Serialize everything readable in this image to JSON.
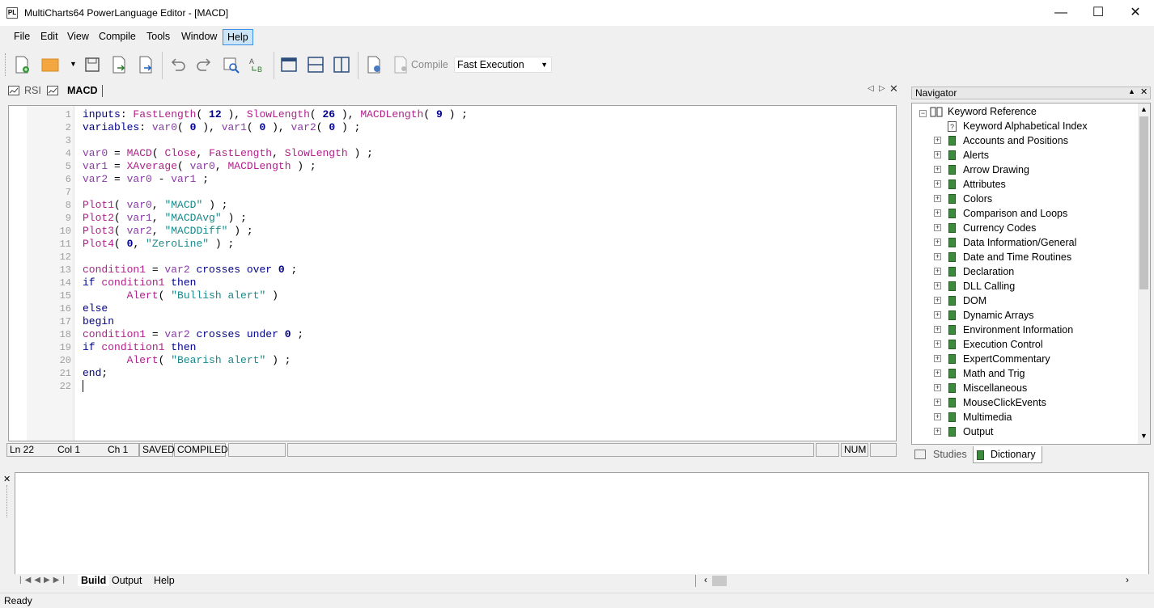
{
  "window": {
    "title": "MultiCharts64 PowerLanguage Editor - [MACD]",
    "app_icon_text": "PL",
    "minimize_icon": "minimize-icon",
    "maximize_icon": "maximize-icon",
    "close_icon": "close-icon"
  },
  "menu": [
    "File",
    "Edit",
    "View",
    "Compile",
    "Tools",
    "Window",
    "Help"
  ],
  "toolbar": {
    "compile_label": "Compile",
    "execution_mode": "Fast Execution"
  },
  "doc_tabs": [
    {
      "label": "RSI",
      "active": false
    },
    {
      "label": "MACD",
      "active": true
    }
  ],
  "editor": {
    "line_numbers": [
      "1",
      "2",
      "3",
      "4",
      "5",
      "6",
      "7",
      "8",
      "9",
      "10",
      "11",
      "12",
      "13",
      "14",
      "15",
      "16",
      "17",
      "18",
      "19",
      "20",
      "21",
      "22"
    ],
    "lines": [
      "inputs: FastLength( 12 ), SlowLength( 26 ), MACDLength( 9 ) ;",
      "variables: var0( 0 ), var1( 0 ), var2( 0 ) ;",
      "",
      "var0 = MACD( Close, FastLength, SlowLength ) ;",
      "var1 = XAverage( var0, MACDLength ) ;",
      "var2 = var0 - var1 ;",
      "",
      "Plot1( var0, \"MACD\" ) ;",
      "Plot2( var1, \"MACDAvg\" ) ;",
      "Plot3( var2, \"MACDDiff\" ) ;",
      "Plot4( 0, \"ZeroLine\" ) ;",
      "",
      "condition1 = var2 crosses over 0 ;",
      "if condition1 then",
      "       Alert( \"Bullish alert\" )",
      "else",
      "begin",
      "condition1 = var2 crosses under 0 ;",
      "if condition1 then",
      "       Alert( \"Bearish alert\" ) ;",
      "end;",
      ""
    ]
  },
  "editor_status": {
    "line": "Ln 22",
    "col": "Col 1",
    "ch": "Ch 1",
    "saved": "SAVED",
    "compiled": "COMPILED",
    "num": "NUM"
  },
  "navigator": {
    "title": "Navigator",
    "root": "Keyword Reference",
    "index": "Keyword Alphabetical Index",
    "items": [
      "Accounts and Positions",
      "Alerts",
      "Arrow Drawing",
      "Attributes",
      "Colors",
      "Comparison and Loops",
      "Currency Codes",
      "Data Information/General",
      "Date and Time Routines",
      "Declaration",
      "DLL Calling",
      "DOM",
      "Dynamic Arrays",
      "Environment Information",
      "Execution Control",
      "ExpertCommentary",
      "Math and Trig",
      "Miscellaneous",
      "MouseClickEvents",
      "Multimedia",
      "Output"
    ],
    "tabs": [
      {
        "label": "Studies",
        "active": false
      },
      {
        "label": "Dictionary",
        "active": true
      }
    ]
  },
  "output_tabs": [
    "Build",
    "Output",
    "Help"
  ],
  "statusbar": {
    "text": "Ready"
  },
  "colors": {
    "keyword": "#00008b",
    "function": "#b0208a",
    "variable": "#8a3ca8",
    "string": "#1a8a8a",
    "menu_active_bg": "#cce4f7",
    "book_icon": "#3c8a3c"
  }
}
